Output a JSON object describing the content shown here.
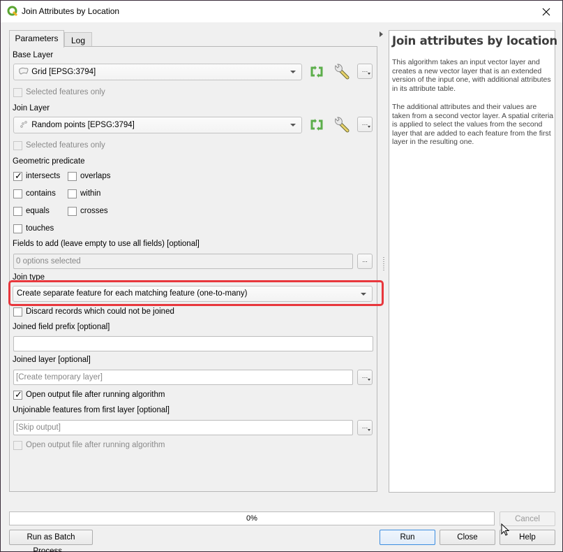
{
  "window": {
    "title": "Join Attributes by Location",
    "close_icon": "close-icon",
    "app_icon": "qgis-logo-icon"
  },
  "tabs": [
    {
      "label": "Parameters",
      "active": true
    },
    {
      "label": "Log",
      "active": false
    }
  ],
  "parameters": {
    "base_layer": {
      "label": "Base Layer",
      "value": "Grid [EPSG:3794]",
      "layer_icon": "polygon-layer-icon",
      "selected_only_label": "Selected features only",
      "selected_only_checked": false,
      "selected_only_enabled": false
    },
    "join_layer": {
      "label": "Join Layer",
      "value": "Random points [EPSG:3794]",
      "layer_icon": "point-layer-icon",
      "selected_only_label": "Selected features only",
      "selected_only_checked": false,
      "selected_only_enabled": false
    },
    "geometric_predicate": {
      "label": "Geometric predicate",
      "options": [
        {
          "label": "intersects",
          "checked": true
        },
        {
          "label": "overlaps",
          "checked": false
        },
        {
          "label": "contains",
          "checked": false
        },
        {
          "label": "within",
          "checked": false
        },
        {
          "label": "equals",
          "checked": false
        },
        {
          "label": "crosses",
          "checked": false
        },
        {
          "label": "touches",
          "checked": false
        }
      ]
    },
    "fields_to_add": {
      "label": "Fields to add (leave empty to use all fields) [optional]",
      "value": "0 options selected",
      "button": "..."
    },
    "join_type": {
      "label": "Join type",
      "value": "Create separate feature for each matching feature (one-to-many)",
      "highlight_color": "#e8373d"
    },
    "discard": {
      "label": "Discard records which could not be joined",
      "checked": false
    },
    "prefix": {
      "label": "Joined field prefix [optional]",
      "value": ""
    },
    "joined_layer": {
      "label": "Joined layer [optional]",
      "placeholder": "[Create temporary layer]",
      "button": "...",
      "open_label": "Open output file after running algorithm",
      "open_checked": true
    },
    "unjoinable": {
      "label": "Unjoinable features from first layer [optional]",
      "placeholder": "[Skip output]",
      "button": "...",
      "open_label": "Open output file after running algorithm",
      "open_checked": false,
      "open_enabled": false
    }
  },
  "help": {
    "title": "Join attributes by location",
    "paragraphs": [
      "This algorithm takes an input vector layer and creates a new vector layer that is an extended version of the input one, with additional attributes in its attribute table.",
      "The additional attributes and their values are taken from a second vector layer. A spatial criteria is applied to select the values from the second layer that are added to each feature from the first layer in the resulting one."
    ]
  },
  "footer": {
    "progress_text": "0%",
    "progress_value": 0,
    "cancel": "Cancel",
    "batch": "Run as Batch Process...",
    "run": "Run",
    "close": "Close",
    "help": "Help"
  }
}
